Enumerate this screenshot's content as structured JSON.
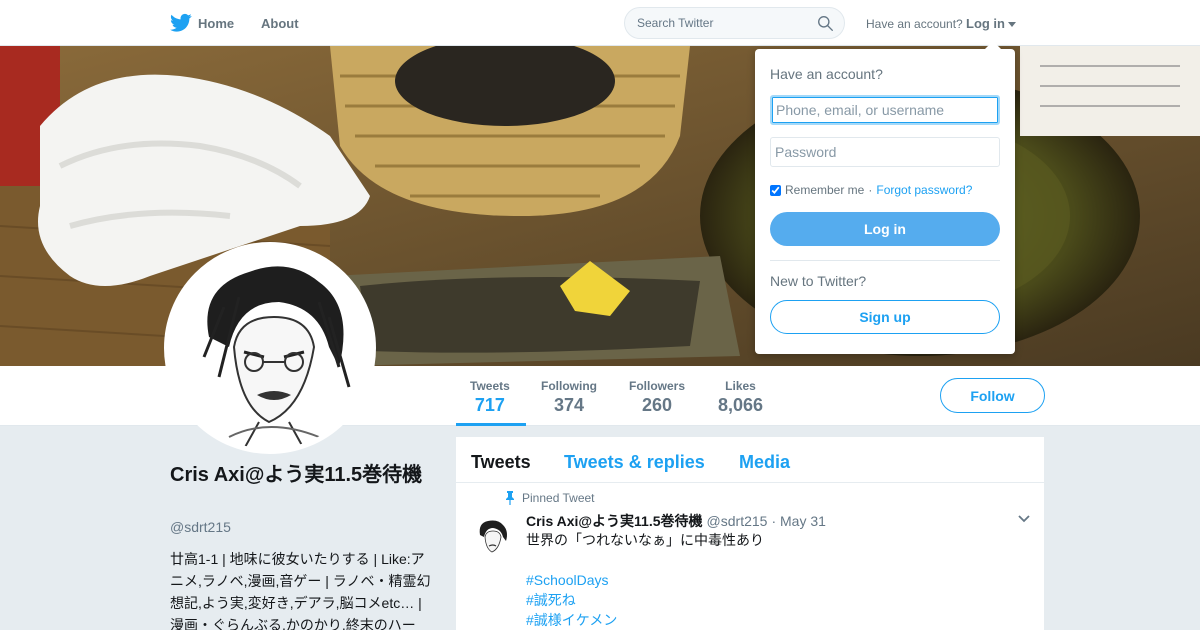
{
  "nav": {
    "home_label": "Home",
    "about_label": "About",
    "search_placeholder": "Search Twitter",
    "have_account_label": "Have an account?",
    "login_label": "Log in"
  },
  "profile": {
    "name": "Cris Axi@よう実11.5巻待機",
    "handle": "@sdrt215",
    "bio": "廿高1-1 | 地味に彼女いたりする | Like:アニメ,ラノベ,漫画,音ゲー | ラノベ・精霊幻想記,よう実,変好き,デアラ,脳コメetc… | 漫画・ぐらんぶる,かのかり,終末のハー"
  },
  "stats": [
    {
      "label": "Tweets",
      "value": "717"
    },
    {
      "label": "Following",
      "value": "374"
    },
    {
      "label": "Followers",
      "value": "260"
    },
    {
      "label": "Likes",
      "value": "8,066"
    }
  ],
  "follow_label": "Follow",
  "timeline": {
    "tabs": [
      "Tweets",
      "Tweets & replies",
      "Media"
    ],
    "pinned_label": "Pinned Tweet",
    "tweet": {
      "name": "Cris Axi@よう実11.5巻待機",
      "handle": "@sdrt215",
      "date": "· May 31",
      "text": "世界の「つれないなぁ」に中毒性あり",
      "hashtags": [
        "#SchoolDays",
        "#誠死ね",
        "#誠様イケメン"
      ]
    }
  },
  "login_dropdown": {
    "title": "Have an account?",
    "username_placeholder": "Phone, email, or username",
    "password_placeholder": "Password",
    "remember_label": "Remember me",
    "separator": "·",
    "forgot_label": "Forgot password?",
    "login_button": "Log in",
    "new_label": "New to Twitter?",
    "signup_button": "Sign up"
  },
  "colors": {
    "accent": "#1da1f2",
    "login_button_bg": "#55acee",
    "page_bg": "#e6ecf0"
  }
}
